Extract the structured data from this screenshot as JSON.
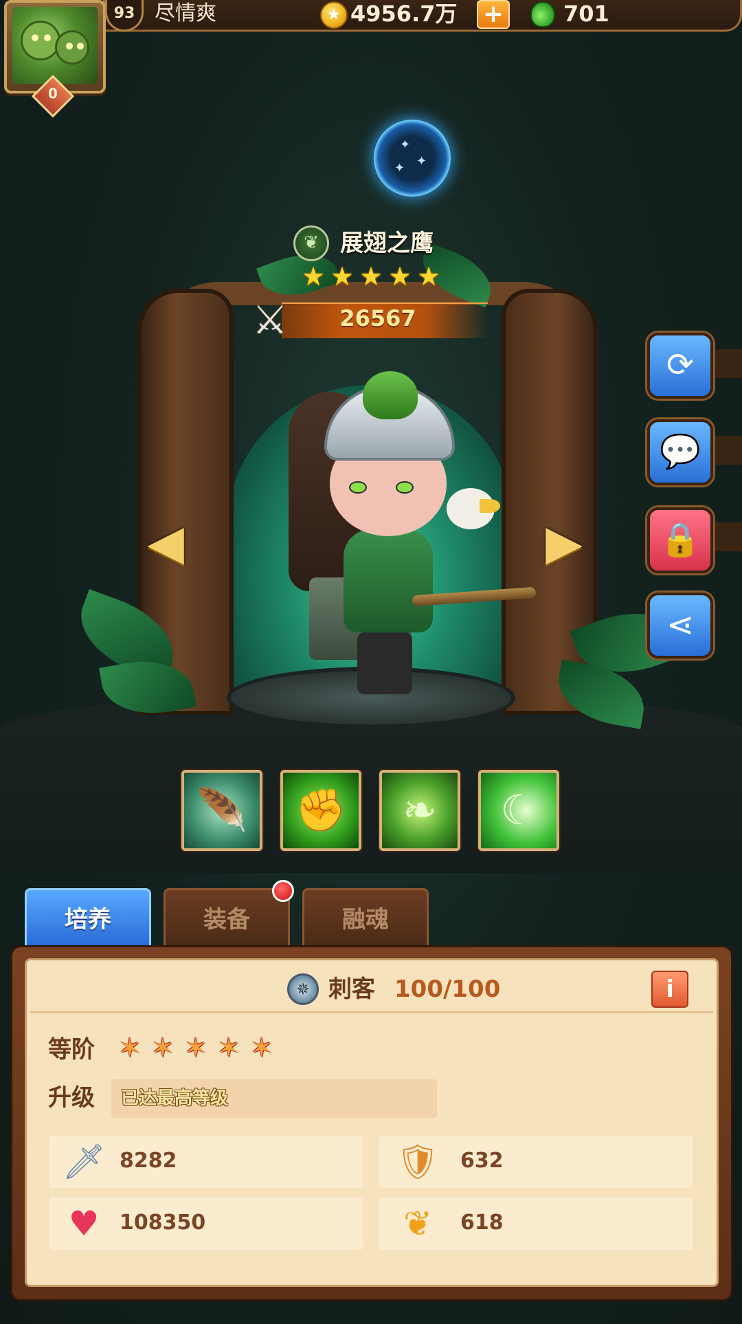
{
  "player": {
    "level": "93",
    "name": "尽情爽",
    "rank": "0"
  },
  "resources": {
    "gold": "4956.7万",
    "potion": "701",
    "plus_label": "+"
  },
  "hero": {
    "name": "展翅之鹰",
    "stars": 5,
    "power": "26567",
    "element_icon": "leaf-element-icon"
  },
  "icons": {
    "refresh": "refresh-icon",
    "chat": "chat-icon",
    "lock": "lock-icon",
    "share": "share-icon"
  },
  "skills": [
    "wind-wing-skill",
    "green-fist-skill",
    "thorn-vine-skill",
    "eagle-spirit-skill"
  ],
  "tabs": {
    "cultivate": "培养",
    "equipment": "装备",
    "soul_fusion": "融魂"
  },
  "panel": {
    "class_name": "刺客",
    "class_progress": "100/100",
    "grade_label": "等阶",
    "grade_stars": 5,
    "upgrade_label": "升级",
    "upgrade_status": "已达最高等级",
    "stats": {
      "attack": "8282",
      "defense": "632",
      "hp": "108350",
      "speed": "618"
    }
  },
  "colors": {
    "active_tab": "#2a6ad6",
    "panel_bg": "#f6e2bd",
    "power_text": "#ffeaa0"
  }
}
